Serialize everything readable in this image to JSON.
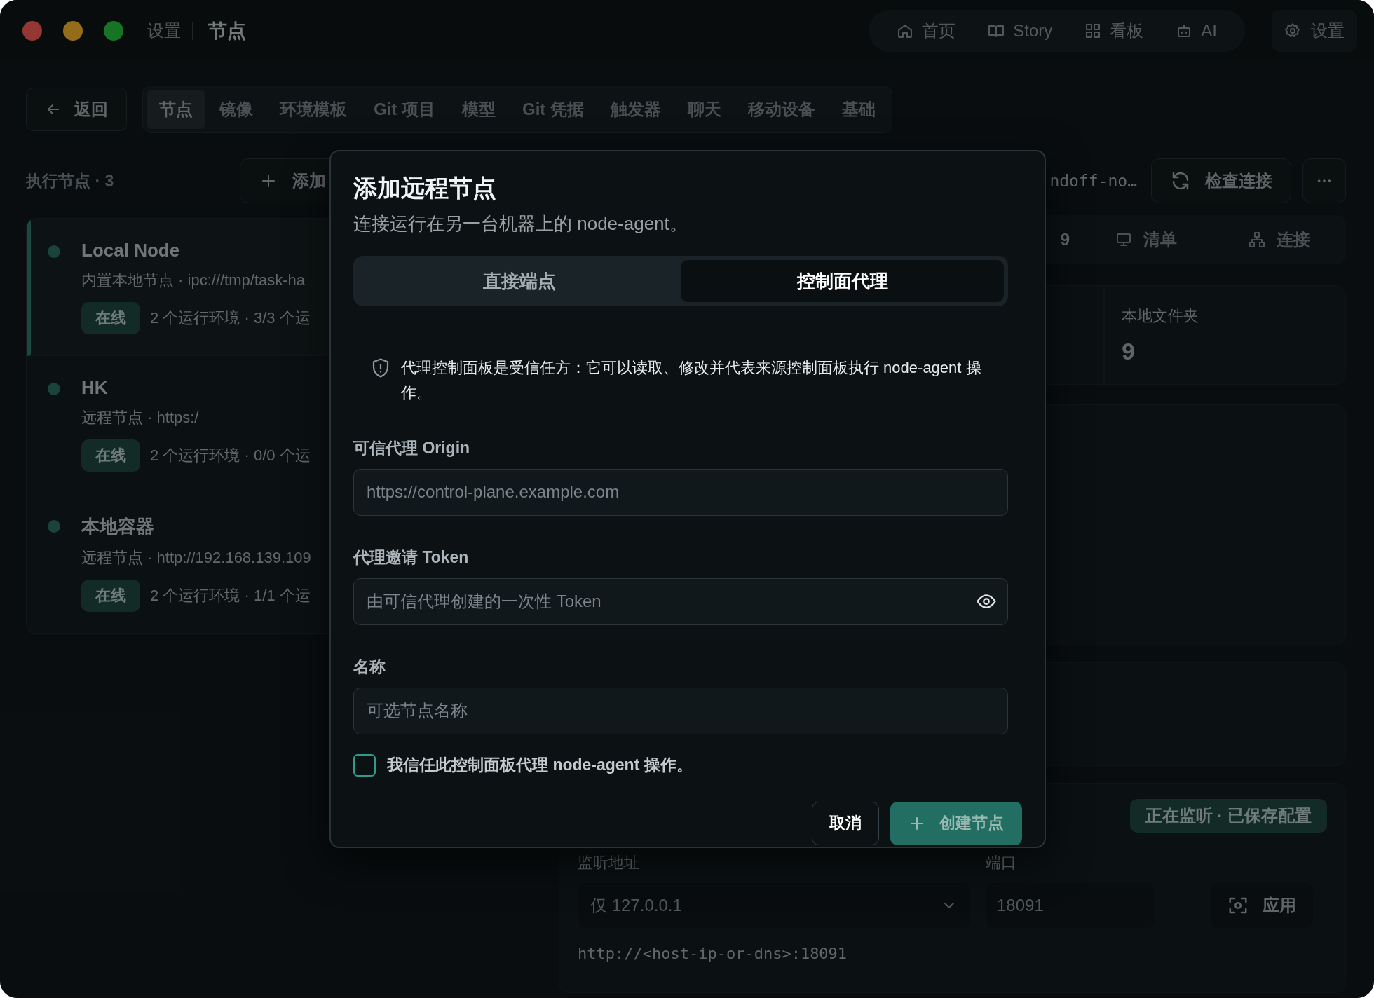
{
  "title_bar": {
    "parent": "设置",
    "title": "节点"
  },
  "top_nav": [
    "首页",
    "Story",
    "看板",
    "AI"
  ],
  "settings_button": "设置",
  "back_button": "返回",
  "section_tabs": [
    {
      "label": "节点",
      "selected": true
    },
    {
      "label": "镜像",
      "selected": false
    },
    {
      "label": "环境模板",
      "selected": false
    },
    {
      "label": "Git 项目",
      "selected": false
    },
    {
      "label": "模型",
      "selected": false
    },
    {
      "label": "Git 凭据",
      "selected": false
    },
    {
      "label": "触发器",
      "selected": false
    },
    {
      "label": "聊天",
      "selected": false
    },
    {
      "label": "移动设备",
      "selected": false
    },
    {
      "label": "基础",
      "selected": false
    }
  ],
  "node_list": {
    "heading": "执行节点 · 3",
    "add_button": "添加",
    "nodes": [
      {
        "name": "Local Node",
        "detail": "内置本地节点 · ipc:///tmp/task-ha",
        "status": "在线",
        "summary": "2 个运行环境 · 3/3 个运",
        "selected": true
      },
      {
        "name": "HK",
        "detail": "远程节点 · https:/",
        "status": "在线",
        "summary": "2 个运行环境 · 0/0 个运",
        "selected": false
      },
      {
        "name": "本地容器",
        "detail": "远程节点 · http://192.168.139.109",
        "status": "在线",
        "summary": "2 个运行环境 · 1/1 个运",
        "selected": false
      }
    ]
  },
  "detail": {
    "endpoint": "ndoff-no…",
    "check_button": "检查连接",
    "tabs": [
      "9",
      "清单",
      "连接"
    ],
    "stat": {
      "label": "本地文件夹",
      "value": "9"
    },
    "listener": {
      "badge": "正在监听 · 已保存配置",
      "address_label": "监听地址",
      "address_value": "仅 127.0.0.1",
      "port_label": "端口",
      "port_value": "18091",
      "apply_button": "应用",
      "url": "http://<host-ip-or-dns>:18091"
    }
  },
  "dialog": {
    "title": "添加远程节点",
    "subtitle": "连接运行在另一台机器上的 node-agent。",
    "modes": [
      {
        "label": "直接端点",
        "selected": false
      },
      {
        "label": "控制面代理",
        "selected": true
      }
    ],
    "notice": "代理控制面板是受信任方：它可以读取、修改并代表来源控制面板执行 node-agent 操作。",
    "fields": [
      {
        "kind": "text",
        "label": "可信代理 Origin",
        "placeholder": "https://control-plane.example.com"
      },
      {
        "kind": "secret",
        "label": "代理邀请 Token",
        "placeholder": "由可信代理创建的一次性 Token"
      },
      {
        "kind": "text",
        "label": "名称",
        "placeholder": "可选节点名称"
      }
    ],
    "consent": {
      "label": "我信任此控制面板代理 node-agent 操作。",
      "checked": false
    },
    "cancel_button": "取消",
    "create_button": {
      "label": "创建节点",
      "disabled": true
    }
  }
}
